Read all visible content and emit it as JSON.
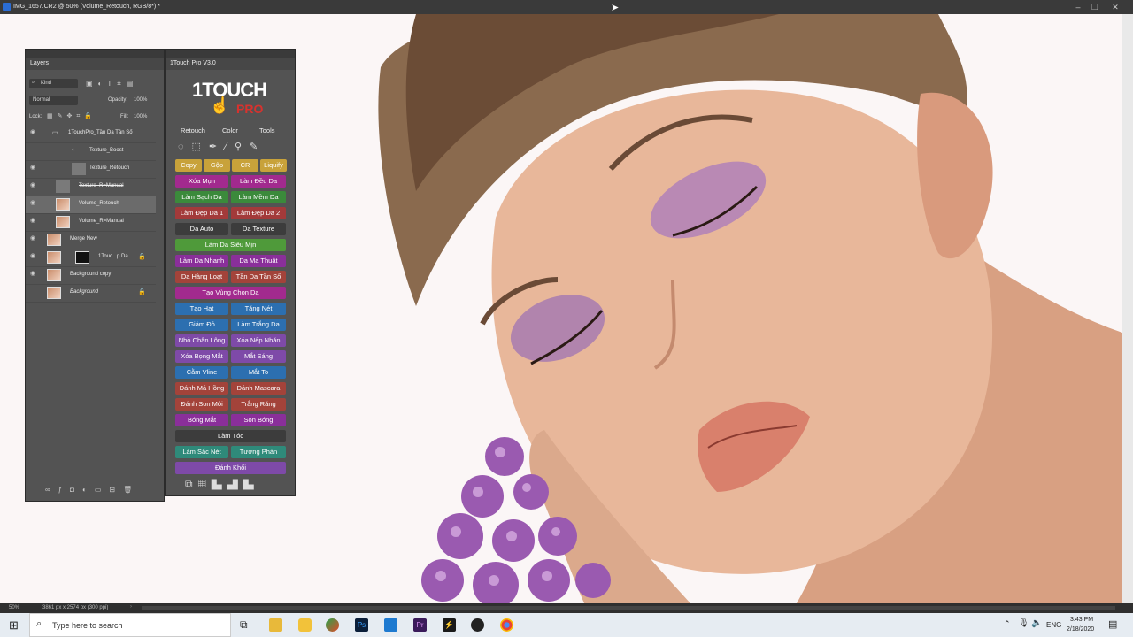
{
  "window": {
    "title": "IMG_1657.CR2 @ 50% (Volume_Retouch, RGB/8*) *"
  },
  "layers_panel": {
    "tab": "Layers",
    "filter_kind": "Kind",
    "blend_mode": "Normal",
    "opacity_label": "Opacity:",
    "opacity_value": "100%",
    "lock_label": "Lock:",
    "fill_label": "Fill:",
    "fill_value": "100%",
    "layers": [
      {
        "name": "1TouchPro_Tần Da Tần Số",
        "visible": true,
        "group": true
      },
      {
        "name": "Texture_Boost",
        "visible": false
      },
      {
        "name": "Texture_Retouch",
        "visible": true
      },
      {
        "name": "Texture_R=Manual",
        "visible": true
      },
      {
        "name": "Volume_Retouch",
        "visible": true,
        "selected": true
      },
      {
        "name": "Volume_R=Manual",
        "visible": true
      },
      {
        "name": "Merge New",
        "visible": true
      },
      {
        "name": "1Touc...p Da",
        "visible": true
      },
      {
        "name": "Background copy",
        "visible": true
      },
      {
        "name": "Background",
        "visible": false
      }
    ]
  },
  "touch_panel": {
    "tab": "1Touch Pro V3.0",
    "logo_text_1": "1TOUCH",
    "logo_text_2": "PRO",
    "tabs": [
      "Retouch",
      "Color",
      "Tools"
    ],
    "row_small": [
      "Copy",
      "Gộp",
      "CR",
      "Liquify"
    ],
    "buttons": [
      [
        "Xóa Mụn",
        "Làm Đều Da"
      ],
      [
        "Làm Sạch Da",
        "Làm Mềm Da"
      ],
      [
        "Làm Đẹp Da 1",
        "Làm Đẹp Da 2"
      ],
      [
        "Da Auto",
        "Da Texture"
      ],
      [
        "Làm Da Siêu Mịn"
      ],
      [
        "Làm Da Nhanh",
        "Da Ma Thuật"
      ],
      [
        "Da Hàng Loạt",
        "Tần Da Tần Số"
      ],
      [
        "Tạo Vùng Chọn Da"
      ],
      [
        "Tạo Hạt",
        "Tăng Nét"
      ],
      [
        "Giảm Đỏ",
        "Làm Trắng Da"
      ],
      [
        "Nhỏ Chân Lông",
        "Xóa Nếp Nhăn"
      ],
      [
        "Xóa Bọng Mắt",
        "Mắt Sáng"
      ],
      [
        "Cằm Vline",
        "Mắt To"
      ],
      [
        "Đánh Má Hồng",
        "Đánh Mascara"
      ],
      [
        "Đánh Son Môi",
        "Trắng Răng"
      ],
      [
        "Bóng Mắt",
        "Son Bóng"
      ],
      [
        "Làm Tóc"
      ],
      [
        "Làm Sắc Nét",
        "Tương Phản"
      ],
      [
        "Đánh Khối"
      ]
    ]
  },
  "status": {
    "zoom": "50%",
    "doc_size": "3861 px x 2574 px (300 ppi)"
  },
  "taskbar": {
    "search_placeholder": "Type here to search",
    "language": "ENG",
    "time": "3:43 PM",
    "date": "2/18/2020"
  }
}
